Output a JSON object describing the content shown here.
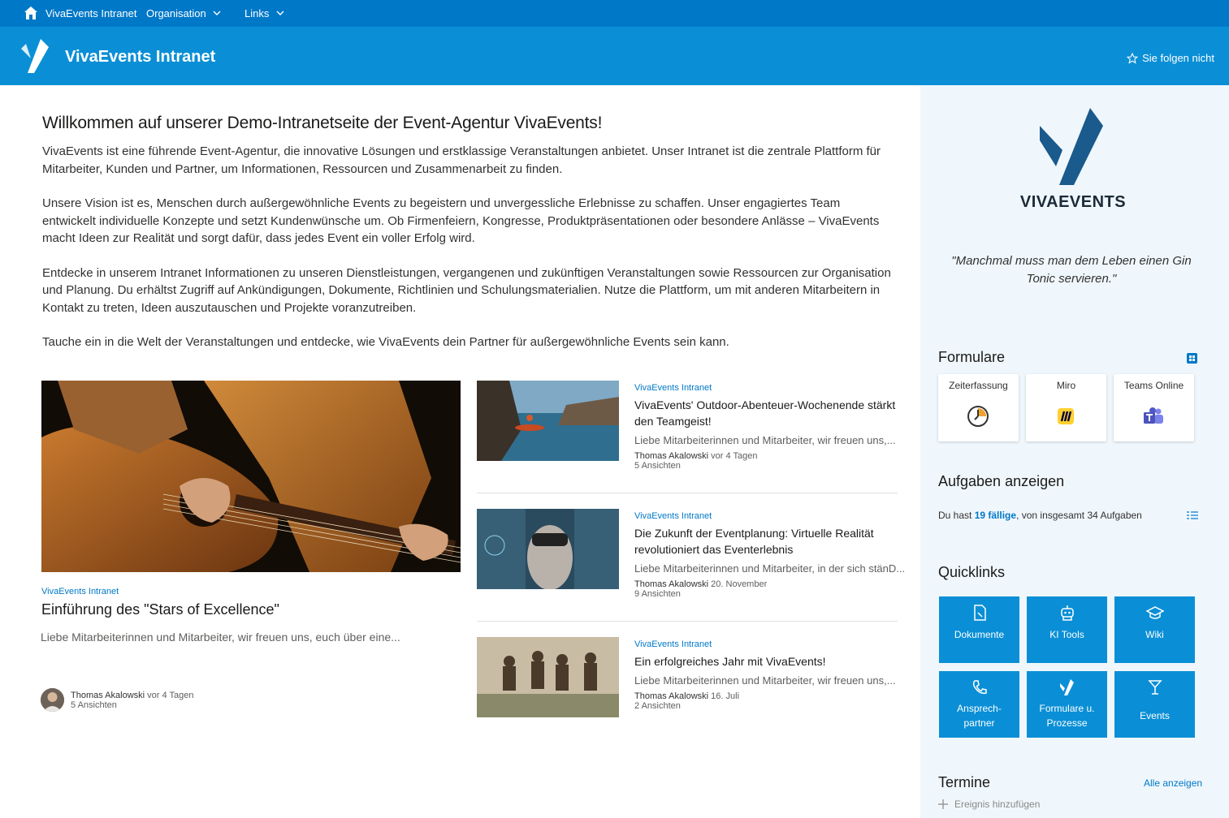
{
  "topnav": {
    "home_label": "VivaEvents Intranet",
    "items": [
      {
        "label": "Organisation"
      },
      {
        "label": "Links"
      }
    ]
  },
  "header": {
    "site_title": "VivaEvents Intranet",
    "follow_label": "Sie folgen nicht"
  },
  "welcome": {
    "title": "Willkommen auf unserer Demo-Intranetseite der Event-Agentur VivaEvents!",
    "paragraphs": [
      "VivaEvents ist eine führende Event-Agentur, die innovative Lösungen und erstklassige Veranstaltungen anbietet. Unser Intranet ist die zentrale Plattform für Mitarbeiter, Kunden und Partner, um Informationen, Ressourcen und Zusammenarbeit zu finden.",
      "Unsere Vision ist es, Menschen durch außergewöhnliche Events zu begeistern und unvergessliche Erlebnisse zu schaffen. Unser engagiertes Team entwickelt individuelle Konzepte und setzt Kundenwünsche um. Ob Firmenfeiern, Kongresse, Produktpräsentationen oder besondere Anlässe – VivaEvents macht Ideen zur Realität und sorgt dafür, dass jedes Event ein voller Erfolg wird.",
      "Entdecke in unserem Intranet Informationen zu unseren Dienstleistungen, vergangenen und zukünftigen Veranstaltungen sowie Ressourcen zur Organisation und Planung. Du erhältst Zugriff auf Ankündigungen, Dokumente, Richtlinien und Schulungsmaterialien. Nutze die Plattform, um mit anderen Mitarbeitern in Kontakt zu treten, Ideen auszutauschen und Projekte voranzutreiben.",
      "Tauche ein in die Welt der Veranstaltungen und entdecke, wie VivaEvents dein Partner für außergewöhnliche Events sein kann."
    ]
  },
  "hero": {
    "site": "VivaEvents Intranet",
    "title": "Einführung des \"Stars of Excellence\"",
    "desc": "Liebe Mitarbeiterinnen und Mitarbeiter, wir freuen uns, euch über eine...",
    "author": "Thomas Akalowski",
    "time": "vor 4 Tagen",
    "views": "5 Ansichten"
  },
  "news": [
    {
      "site": "VivaEvents Intranet",
      "title": "VivaEvents' Outdoor-Abenteuer-Wochenende stärkt den Teamgeist!",
      "desc": "Liebe Mitarbeiterinnen und Mitarbeiter, wir freuen uns,...",
      "author": "Thomas Akalowski",
      "time": "vor 4 Tagen",
      "views": "5 Ansichten"
    },
    {
      "site": "VivaEvents Intranet",
      "title": "Die Zukunft der Eventplanung: Virtuelle Realität revolutioniert das Eventerlebnis",
      "desc": "Liebe Mitarbeiterinnen und Mitarbeiter, in der sich stänD...",
      "author": "Thomas Akalowski",
      "time": "20. November",
      "views": "9 Ansichten"
    },
    {
      "site": "VivaEvents Intranet",
      "title": "Ein erfolgreiches Jahr mit VivaEvents!",
      "desc": "Liebe Mitarbeiterinnen und Mitarbeiter, wir freuen uns,...",
      "author": "Thomas Akalowski",
      "time": "16. Juli",
      "views": "2 Ansichten"
    }
  ],
  "sidebar": {
    "logo_text": "VIVAEVENTS",
    "quote": "\"Manchmal muss man dem Leben einen Gin Tonic servieren.\"",
    "formulare": {
      "title": "Formulare",
      "cards": [
        {
          "label": "Zeiterfassung",
          "icon": "clock-icon"
        },
        {
          "label": "Miro",
          "icon": "miro-icon"
        },
        {
          "label": "Teams Online",
          "icon": "teams-icon"
        }
      ]
    },
    "tasks": {
      "title": "Aufgaben anzeigen",
      "prefix": "Du hast",
      "count": "19 fällige",
      "suffix": ", von insgesamt 34 Aufgaben"
    },
    "quicklinks": {
      "title": "Quicklinks",
      "items": [
        {
          "label": "Dokumente",
          "icon": "document-icon"
        },
        {
          "label": "KI Tools",
          "icon": "robot-icon"
        },
        {
          "label": "Wiki",
          "icon": "graduation-cap-icon"
        },
        {
          "label1": "Ansprech-",
          "label2": "partner",
          "icon": "phone-icon"
        },
        {
          "label1": "Formulare u.",
          "label2": "Prozesse",
          "icon": "viva-logo-icon"
        },
        {
          "label": "Events",
          "icon": "cocktail-glass-icon"
        }
      ]
    },
    "termine": {
      "title": "Termine",
      "all_label": "Alle anzeigen",
      "add_label": "Ereignis hinzufügen"
    }
  },
  "colors": {
    "topnav": "#0078c8",
    "header": "#0a8fd6",
    "accent": "#0078c8",
    "sidebar_bg": "#eff7fc",
    "logo_dark": "#1a5a8c"
  }
}
